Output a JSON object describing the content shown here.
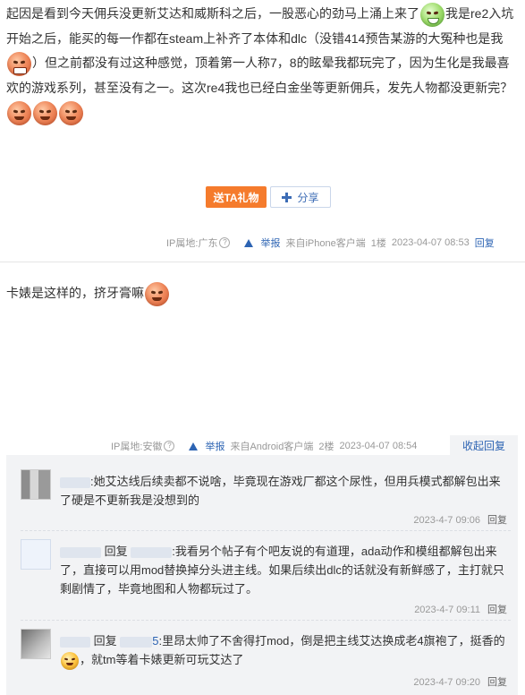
{
  "post1": {
    "text": [
      "起因是看到今天佣兵没更新艾达和威斯科之后，一股恶心的劲马上涌上来了",
      "我是re2入坑开始之后，能买的每一作都在steam上补齐了本体和dlc（没错414预告某游的大冤种也是我",
      "）但之前都没有过这种感觉，顶着第一人称7，8的眩晕我都玩完了，因为生化是我最喜欢的游戏系列，甚至没有之一。这次re4我也已经白金坐等更新佣兵，发先人物都没更新完？"
    ],
    "gift_button": "送TA礼物",
    "share_button": "分享",
    "meta": {
      "ip": "IP属地:广东",
      "report": "举报",
      "source": "来自iPhone客户端",
      "floor": "1楼",
      "time": "2023-04-07 08:53",
      "reply": "回复"
    }
  },
  "post2": {
    "text": "卡婊是这样的，挤牙膏嘛",
    "meta": {
      "ip": "IP属地:安徽",
      "report": "举报",
      "source": "来自Android客户端",
      "floor": "2楼",
      "time": "2023-04-07 08:54",
      "collapse": "收起回复"
    }
  },
  "replies": [
    {
      "text": ":她艾达线后续卖都不说啥，毕竟现在游戏厂都这个尿性，但用兵模式都解包出来了硬是不更新我是没想到的",
      "time": "2023-4-7 09:06",
      "reply": "回复"
    },
    {
      "reply_word": "回复",
      "text": ":我看另个帖子有个吧友说的有道理，ada动作和模组都解包出来了，直接可以用mod替换掉分头进主线。如果后续出dlc的话就没有新鲜感了，主打就只剩剧情了，毕竟地图和人物都玩过了。",
      "time": "2023-4-7 09:11",
      "reply": "回复"
    },
    {
      "reply_word": "回复",
      "name_tail": "5",
      "text_a": ":里昂太帅了不舍得打mod，倒是把主线艾达换成老4旗袍了，挺香的",
      "text_b": "，就tm等着卡婊更新可玩艾达了",
      "time": "2023-4-7 09:20",
      "reply": "回复"
    }
  ]
}
